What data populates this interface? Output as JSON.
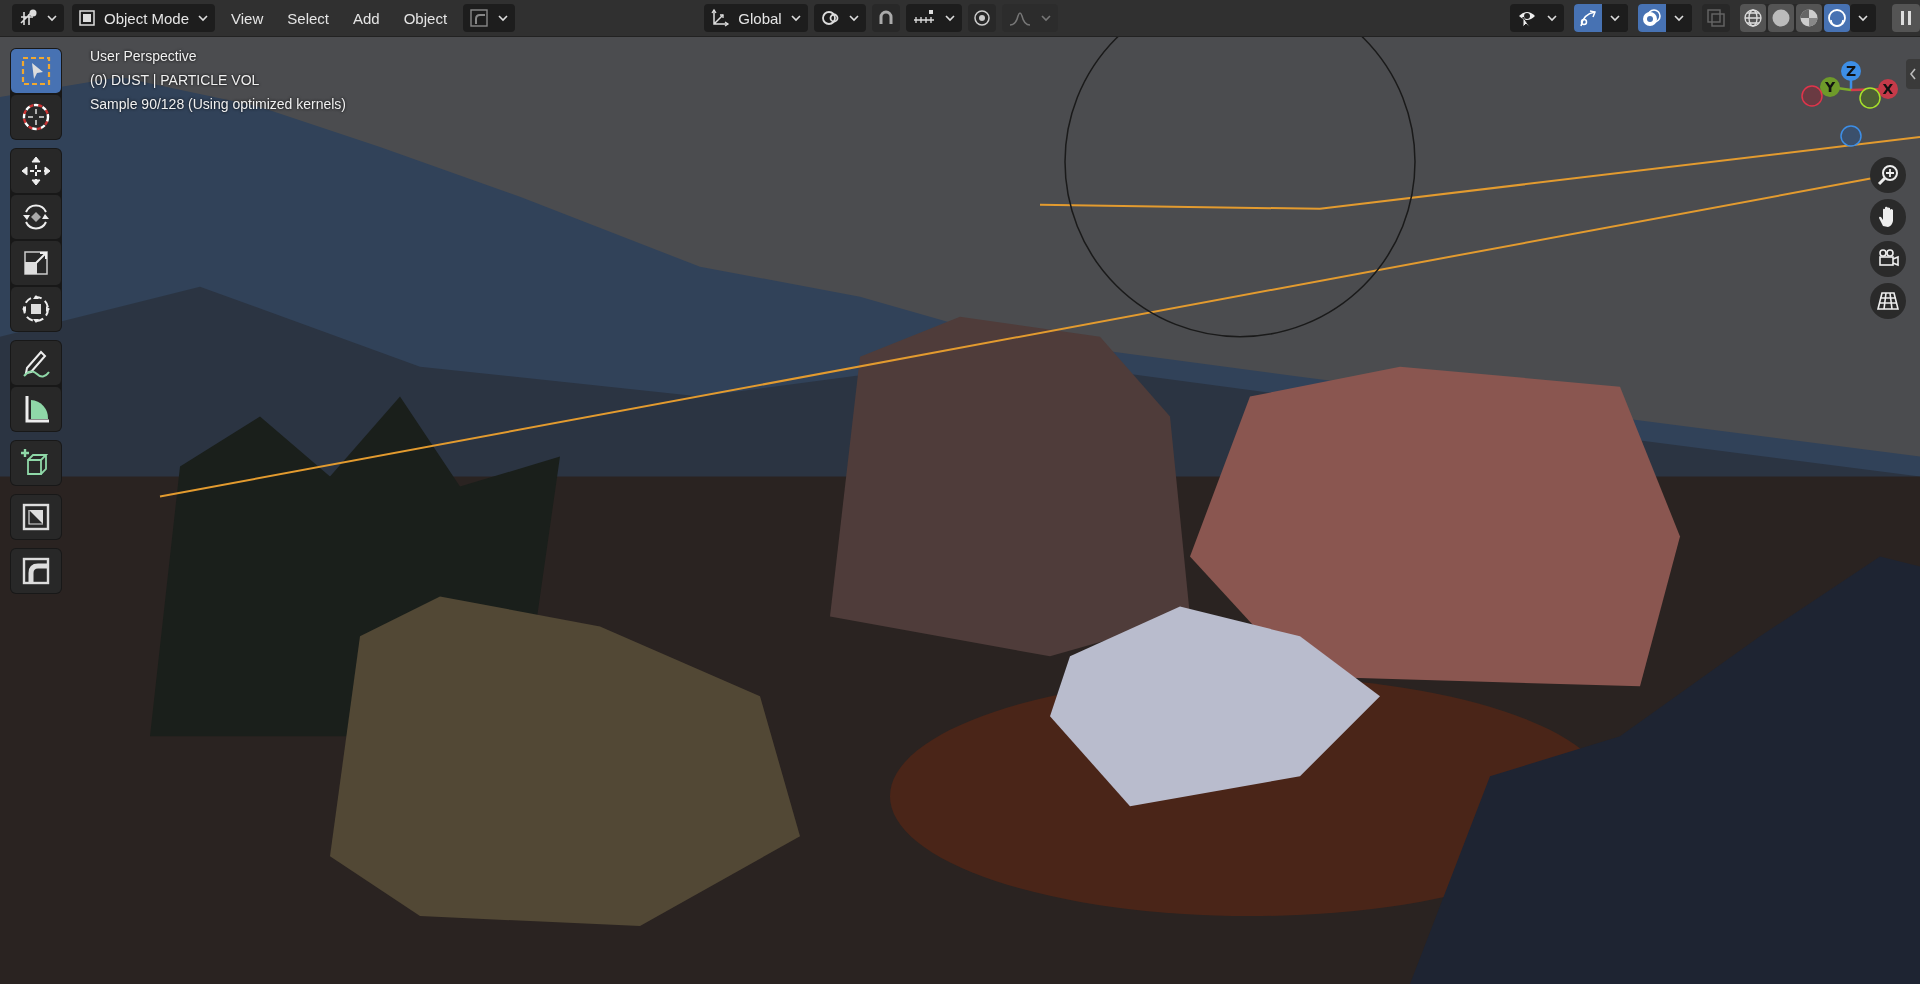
{
  "header": {
    "mode": "Object Mode",
    "menus": [
      "View",
      "Select",
      "Add",
      "Object"
    ],
    "orientation": "Global",
    "snap_on": false,
    "proportional_on": false,
    "falloff_disabled": true,
    "gizmos_on": true,
    "overlays_on": true,
    "xray_on": false,
    "shading": [
      {
        "kind": "wireframe",
        "selected": false
      },
      {
        "kind": "solid",
        "selected": false
      },
      {
        "kind": "material",
        "selected": false
      },
      {
        "kind": "rendered",
        "selected": true
      }
    ]
  },
  "toolbar": {
    "groups": [
      [
        {
          "kind": "select",
          "selected": true
        },
        {
          "kind": "cursor",
          "selected": false
        }
      ],
      [
        {
          "kind": "move",
          "selected": false
        },
        {
          "kind": "rotate",
          "selected": false
        },
        {
          "kind": "scale",
          "selected": false
        },
        {
          "kind": "transform",
          "selected": false
        }
      ],
      [
        {
          "kind": "annotate",
          "selected": false
        },
        {
          "kind": "measure",
          "selected": false
        }
      ],
      [
        {
          "kind": "add_cube",
          "selected": false
        }
      ],
      [
        {
          "kind": "inset",
          "selected": false
        }
      ],
      [
        {
          "kind": "bevel",
          "selected": false
        }
      ]
    ]
  },
  "viewport_info": [
    "User Perspective",
    "(0) DUST | PARTICLE VOL",
    "Sample 90/128 (Using optimized kernels)"
  ],
  "gizmo": {
    "axes": [
      {
        "label": "Z"
      },
      {
        "label": "Y"
      },
      {
        "label": "X"
      }
    ]
  },
  "navigation": [
    {
      "kind": "zoom"
    },
    {
      "kind": "pan"
    },
    {
      "kind": "camera"
    },
    {
      "kind": "perspective"
    }
  ]
}
